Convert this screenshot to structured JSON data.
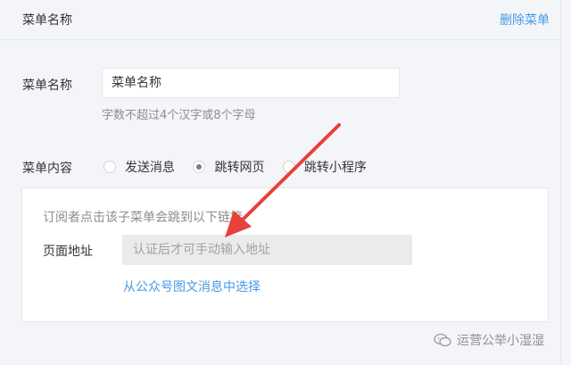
{
  "header": {
    "title": "菜单名称",
    "delete_label": "删除菜单"
  },
  "menu_name": {
    "label": "菜单名称",
    "value": "菜单名称",
    "hint": "字数不超过4个汉字或8个字母"
  },
  "menu_content": {
    "label": "菜单内容",
    "options": [
      {
        "label": "发送消息",
        "checked": false
      },
      {
        "label": "跳转网页",
        "checked": true
      },
      {
        "label": "跳转小程序",
        "checked": false
      }
    ]
  },
  "link_panel": {
    "description": "订阅者点击该子菜单会跳到以下链接",
    "address_label": "页面地址",
    "address_placeholder": "认证后才可手动输入地址",
    "select_link": "从公众号图文消息中选择"
  },
  "annotation": {
    "arrow_color": "#e8403a"
  },
  "watermark": {
    "text": "运营公举小湿湿",
    "icon": "wechat-icon"
  }
}
